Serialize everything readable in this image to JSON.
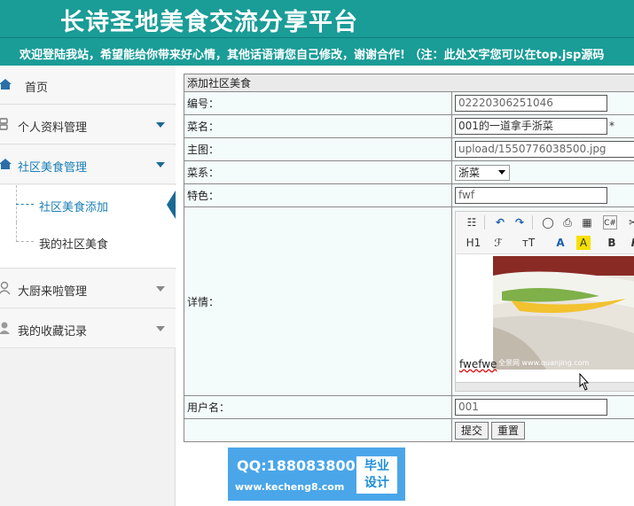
{
  "header": {
    "title": "长诗圣地美食交流分享平台",
    "marquee": "欢迎登陆我站，希望能给你带来好心情，其他话语请您自己修改，谢谢合作!  （注：此处文字您可以在top.jsp源码"
  },
  "sidebar": {
    "home": "首页",
    "items": [
      {
        "label": "个人资料管理"
      },
      {
        "label": "社区美食管理"
      },
      {
        "label": "大厨来啦管理"
      },
      {
        "label": "我的收藏记录"
      }
    ],
    "sub_items": [
      {
        "label": "社区美食添加"
      },
      {
        "label": "我的社区美食"
      }
    ]
  },
  "form": {
    "heading": "添加社区美食",
    "fields": {
      "id_label": "编号：",
      "id_value": "02220306251046",
      "name_label": "菜名：",
      "name_value": "001的一道拿手浙菜",
      "required_mark": "*",
      "image_label": "主图：",
      "image_value": "upload/1550776038500.jpg",
      "cuisine_label": "菜系：",
      "cuisine_value": "浙菜",
      "feature_label": "特色：",
      "feature_value": "fwf",
      "detail_label": "详情：",
      "detail_text": "fwefwe",
      "user_label": "用户名：",
      "user_value": "001"
    },
    "buttons": {
      "submit": "提交",
      "reset": "重置"
    },
    "editor": {
      "h1": "H1",
      "font": "ℱ",
      "size": "тT",
      "font_color": "A",
      "bg_color": "A",
      "bold": "B",
      "italic": "I",
      "image_caption": "全景网 www.quanjing.com"
    }
  },
  "watermark": {
    "qq": "QQ:188083800",
    "site": "www.kecheng8.com",
    "badge_line1": "毕业",
    "badge_line2": "设计"
  },
  "colors": {
    "header_bg": "#1a9c97",
    "active": "#1a7fb5",
    "watermark": "#4aa6e8"
  }
}
